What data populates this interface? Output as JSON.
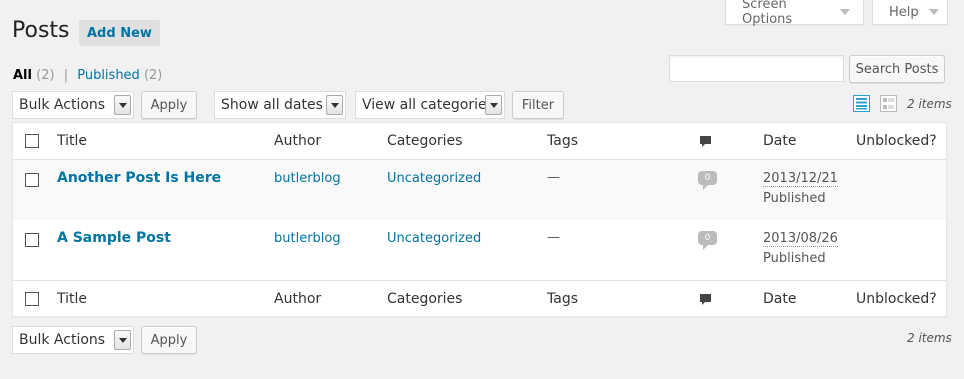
{
  "screen_meta": {
    "screen_options_label": "Screen Options",
    "help_label": "Help"
  },
  "header": {
    "title": "Posts",
    "add_new_label": "Add New"
  },
  "views": {
    "all_label": "All",
    "all_count": "(2)",
    "separator": "|",
    "published_label": "Published",
    "published_count": "(2)"
  },
  "search": {
    "value": "",
    "button_label": "Search Posts"
  },
  "top_nav": {
    "bulk_actions_selected": "Bulk Actions",
    "apply_label": "Apply",
    "dates_selected": "Show all dates",
    "categories_selected": "View all categories",
    "filter_label": "Filter",
    "items_count": "2 items"
  },
  "bottom_nav": {
    "bulk_actions_selected": "Bulk Actions",
    "apply_label": "Apply",
    "items_count": "2 items"
  },
  "columns": {
    "title": "Title",
    "author": "Author",
    "categories": "Categories",
    "tags": "Tags",
    "date": "Date",
    "unblocked": "Unblocked?"
  },
  "posts": [
    {
      "title": "Another Post Is Here",
      "author": "butlerblog",
      "category": "Uncategorized",
      "tags": "—",
      "comments": "0",
      "date": "2013/12/21",
      "status": "Published"
    },
    {
      "title": "A Sample Post",
      "author": "butlerblog",
      "category": "Uncategorized",
      "tags": "—",
      "comments": "0",
      "date": "2013/08/26",
      "status": "Published"
    }
  ],
  "colors": {
    "link": "#0074a2",
    "background": "#f1f1f1",
    "active_view_icon": "#2ea2cc"
  },
  "icons": {
    "comment_column": "comment-bubble-icon",
    "list_view": "list-view-icon",
    "excerpt_view": "excerpt-view-icon"
  }
}
